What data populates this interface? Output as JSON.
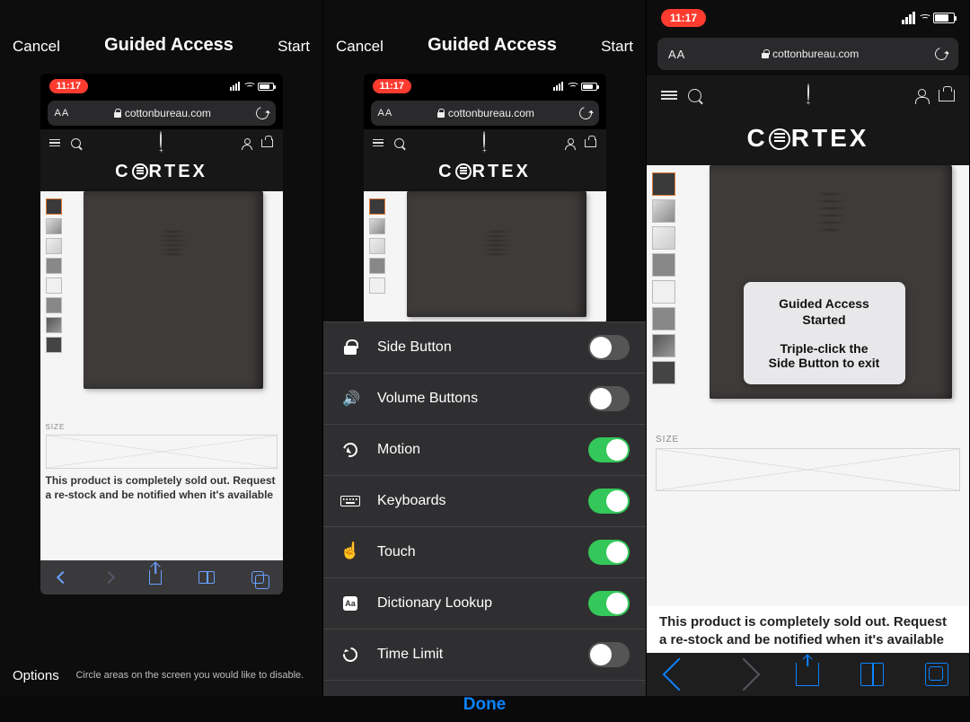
{
  "guided_access": {
    "cancel": "Cancel",
    "title": "Guided Access",
    "start": "Start",
    "options": "Options",
    "hint": "Circle areas on the screen you would like to disable.",
    "done": "Done"
  },
  "status": {
    "time": "11:17"
  },
  "safari": {
    "aa": "AA",
    "domain": "cottonbureau.com"
  },
  "site": {
    "brand_pre": "C",
    "brand_post": "RTEX",
    "size_label": "SIZE",
    "soldout": "This product is completely sold out. Request a re-stock and be notified when it's available"
  },
  "options_list": [
    {
      "key": "side_button",
      "label": "Side Button",
      "on": false,
      "icon": "lock"
    },
    {
      "key": "volume",
      "label": "Volume Buttons",
      "on": false,
      "icon": "speaker"
    },
    {
      "key": "motion",
      "label": "Motion",
      "on": true,
      "icon": "motion"
    },
    {
      "key": "keyboards",
      "label": "Keyboards",
      "on": true,
      "icon": "keyboard"
    },
    {
      "key": "touch",
      "label": "Touch",
      "on": true,
      "icon": "touch"
    },
    {
      "key": "dictionary",
      "label": "Dictionary Lookup",
      "on": true,
      "icon": "dict"
    },
    {
      "key": "time_limit",
      "label": "Time Limit",
      "on": false,
      "icon": "timer"
    }
  ],
  "toast": {
    "line1": "Guided Access",
    "line2": "Started",
    "line3": "Triple-click the",
    "line4": "Side Button to exit"
  }
}
